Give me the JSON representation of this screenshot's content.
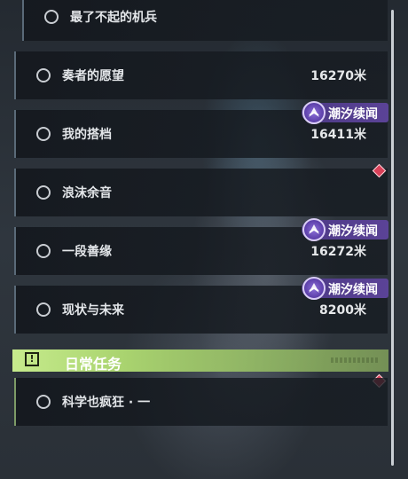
{
  "quests": [
    {
      "name": "最了不起的机兵",
      "distance": ""
    },
    {
      "name": "奏者的愿望",
      "distance": "16270米"
    },
    {
      "name": "我的搭档",
      "distance": "16411米",
      "tag": "潮汐续闻"
    },
    {
      "name": "浪沫余音",
      "distance": ""
    },
    {
      "name": "一段善缘",
      "distance": "16272米",
      "tag": "潮汐续闻"
    },
    {
      "name": "现状与未来",
      "distance": "8200米",
      "tag": "潮汐续闻"
    }
  ],
  "daily_section": {
    "title": "日常任务",
    "icon": "exclamation-box-icon",
    "quests": [
      {
        "name": "科学也疯狂 · 一",
        "distance": ""
      }
    ]
  },
  "colors": {
    "tag_purple": "#5b4397",
    "daily_green": "#b9e07e",
    "marker_red": "#d94058"
  }
}
